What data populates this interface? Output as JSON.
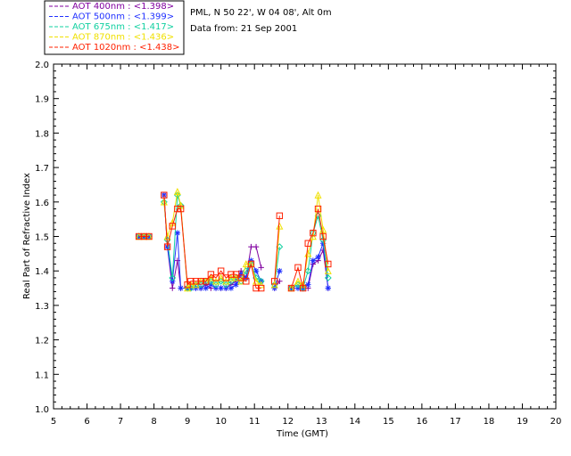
{
  "chart_data": {
    "type": "line",
    "xlabel": "Time (GMT)",
    "ylabel": "Real Part of Refractive Index",
    "xlim": [
      5,
      20
    ],
    "ylim": [
      1.0,
      2.0
    ],
    "xticks": [
      "5",
      "6",
      "7",
      "8",
      "9",
      "10",
      "11",
      "12",
      "13",
      "14",
      "15",
      "16",
      "17",
      "18",
      "19",
      "20"
    ],
    "yticks": [
      "1.0",
      "1.1",
      "1.2",
      "1.3",
      "1.4",
      "1.5",
      "1.6",
      "1.7",
      "1.8",
      "1.9",
      "2.0"
    ],
    "grid": false,
    "legend_position": "top-left",
    "info_lines": [
      "PML, N 50 22', W 04 08', Alt 0m",
      "Data from: 21 Sep 2001"
    ],
    "series": [
      {
        "name": "AOT  400nm : <1.398>",
        "color": "#8000a0",
        "marker": "plus",
        "points": [
          [
            7.55,
            1.5
          ],
          [
            7.7,
            1.5
          ],
          [
            7.85,
            1.5
          ],
          [
            8.3,
            1.62
          ],
          [
            8.4,
            1.47
          ],
          [
            8.55,
            1.35
          ],
          [
            8.7,
            1.43
          ],
          [
            8.8,
            1.35
          ],
          [
            9.0,
            1.35
          ],
          [
            9.1,
            1.35
          ],
          [
            9.25,
            1.35
          ],
          [
            9.4,
            1.35
          ],
          [
            9.55,
            1.36
          ],
          [
            9.7,
            1.35
          ],
          [
            9.85,
            1.35
          ],
          [
            10.0,
            1.35
          ],
          [
            10.15,
            1.35
          ],
          [
            10.3,
            1.36
          ],
          [
            10.45,
            1.37
          ],
          [
            10.6,
            1.4
          ],
          [
            10.75,
            1.38
          ],
          [
            10.9,
            1.47
          ],
          [
            11.05,
            1.47
          ],
          [
            11.2,
            1.41
          ],
          [
            11.6,
            1.35
          ],
          [
            11.75,
            1.37
          ],
          [
            12.1,
            1.35
          ],
          [
            12.3,
            1.35
          ],
          [
            12.45,
            1.35
          ],
          [
            12.6,
            1.35
          ],
          [
            12.75,
            1.42
          ],
          [
            12.9,
            1.43
          ],
          [
            13.05,
            1.46
          ],
          [
            13.2,
            1.35
          ]
        ]
      },
      {
        "name": "AOT  500nm : <1.399>",
        "color": "#2030ff",
        "marker": "asterisk",
        "points": [
          [
            7.55,
            1.5
          ],
          [
            7.7,
            1.5
          ],
          [
            7.85,
            1.5
          ],
          [
            8.3,
            1.62
          ],
          [
            8.4,
            1.47
          ],
          [
            8.55,
            1.37
          ],
          [
            8.7,
            1.51
          ],
          [
            8.8,
            1.35
          ],
          [
            9.0,
            1.35
          ],
          [
            9.1,
            1.35
          ],
          [
            9.25,
            1.35
          ],
          [
            9.4,
            1.35
          ],
          [
            9.55,
            1.35
          ],
          [
            9.7,
            1.36
          ],
          [
            9.85,
            1.35
          ],
          [
            10.0,
            1.35
          ],
          [
            10.15,
            1.35
          ],
          [
            10.3,
            1.35
          ],
          [
            10.45,
            1.36
          ],
          [
            10.6,
            1.39
          ],
          [
            10.75,
            1.38
          ],
          [
            10.9,
            1.43
          ],
          [
            11.05,
            1.4
          ],
          [
            11.2,
            1.37
          ],
          [
            11.6,
            1.35
          ],
          [
            11.75,
            1.4
          ],
          [
            12.1,
            1.35
          ],
          [
            12.3,
            1.35
          ],
          [
            12.45,
            1.35
          ],
          [
            12.6,
            1.36
          ],
          [
            12.75,
            1.43
          ],
          [
            12.9,
            1.44
          ],
          [
            13.05,
            1.48
          ],
          [
            13.2,
            1.35
          ]
        ]
      },
      {
        "name": "AOT  675nm : <1.417>",
        "color": "#10d0a0",
        "marker": "diamond",
        "points": [
          [
            7.55,
            1.5
          ],
          [
            7.7,
            1.5
          ],
          [
            7.85,
            1.5
          ],
          [
            8.3,
            1.6
          ],
          [
            8.4,
            1.49
          ],
          [
            8.55,
            1.38
          ],
          [
            8.7,
            1.62
          ],
          [
            8.8,
            1.59
          ],
          [
            9.0,
            1.35
          ],
          [
            9.1,
            1.35
          ],
          [
            9.25,
            1.36
          ],
          [
            9.4,
            1.36
          ],
          [
            9.55,
            1.37
          ],
          [
            9.7,
            1.37
          ],
          [
            9.85,
            1.36
          ],
          [
            10.0,
            1.37
          ],
          [
            10.15,
            1.36
          ],
          [
            10.3,
            1.37
          ],
          [
            10.45,
            1.38
          ],
          [
            10.6,
            1.37
          ],
          [
            10.75,
            1.4
          ],
          [
            10.9,
            1.42
          ],
          [
            11.05,
            1.38
          ],
          [
            11.2,
            1.37
          ],
          [
            11.6,
            1.36
          ],
          [
            11.75,
            1.47
          ],
          [
            12.1,
            1.35
          ],
          [
            12.3,
            1.36
          ],
          [
            12.45,
            1.35
          ],
          [
            12.6,
            1.4
          ],
          [
            12.75,
            1.51
          ],
          [
            12.9,
            1.56
          ],
          [
            13.05,
            1.49
          ],
          [
            13.2,
            1.38
          ]
        ]
      },
      {
        "name": "AOT  870nm : <1.436>",
        "color": "#f0e000",
        "marker": "triangle",
        "points": [
          [
            7.55,
            1.5
          ],
          [
            7.7,
            1.5
          ],
          [
            7.85,
            1.5
          ],
          [
            8.3,
            1.6
          ],
          [
            8.4,
            1.5
          ],
          [
            8.55,
            1.54
          ],
          [
            8.7,
            1.63
          ],
          [
            8.8,
            1.59
          ],
          [
            9.0,
            1.35
          ],
          [
            9.1,
            1.36
          ],
          [
            9.25,
            1.36
          ],
          [
            9.4,
            1.37
          ],
          [
            9.55,
            1.37
          ],
          [
            9.7,
            1.38
          ],
          [
            9.85,
            1.37
          ],
          [
            10.0,
            1.38
          ],
          [
            10.15,
            1.37
          ],
          [
            10.3,
            1.38
          ],
          [
            10.45,
            1.38
          ],
          [
            10.6,
            1.37
          ],
          [
            10.75,
            1.42
          ],
          [
            10.9,
            1.42
          ],
          [
            11.05,
            1.37
          ],
          [
            11.2,
            1.36
          ],
          [
            11.6,
            1.36
          ],
          [
            11.75,
            1.53
          ],
          [
            12.1,
            1.35
          ],
          [
            12.3,
            1.37
          ],
          [
            12.45,
            1.36
          ],
          [
            12.6,
            1.45
          ],
          [
            12.75,
            1.5
          ],
          [
            12.9,
            1.62
          ],
          [
            13.05,
            1.52
          ],
          [
            13.2,
            1.4
          ]
        ]
      },
      {
        "name": "AOT 1020nm : <1.438>",
        "color": "#ff2000",
        "marker": "square",
        "points": [
          [
            7.55,
            1.5
          ],
          [
            7.7,
            1.5
          ],
          [
            7.85,
            1.5
          ],
          [
            8.3,
            1.62
          ],
          [
            8.4,
            1.47
          ],
          [
            8.55,
            1.53
          ],
          [
            8.7,
            1.58
          ],
          [
            8.8,
            1.58
          ],
          [
            9.0,
            1.36
          ],
          [
            9.1,
            1.37
          ],
          [
            9.25,
            1.37
          ],
          [
            9.4,
            1.37
          ],
          [
            9.55,
            1.37
          ],
          [
            9.7,
            1.39
          ],
          [
            9.85,
            1.38
          ],
          [
            10.0,
            1.4
          ],
          [
            10.15,
            1.38
          ],
          [
            10.3,
            1.39
          ],
          [
            10.45,
            1.39
          ],
          [
            10.6,
            1.38
          ],
          [
            10.75,
            1.37
          ],
          [
            10.9,
            1.42
          ],
          [
            11.05,
            1.35
          ],
          [
            11.2,
            1.35
          ],
          [
            11.6,
            1.37
          ],
          [
            11.75,
            1.56
          ],
          [
            12.1,
            1.35
          ],
          [
            12.3,
            1.41
          ],
          [
            12.45,
            1.35
          ],
          [
            12.6,
            1.48
          ],
          [
            12.75,
            1.51
          ],
          [
            12.9,
            1.58
          ],
          [
            13.05,
            1.5
          ],
          [
            13.2,
            1.42
          ]
        ]
      }
    ]
  }
}
